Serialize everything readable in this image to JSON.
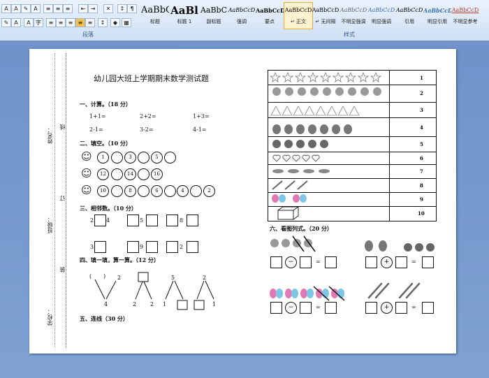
{
  "ribbon": {
    "paragraph_group_label": "段落",
    "styles_group_label": "样式",
    "styles": [
      {
        "sample": "AaBbC",
        "name": "标题"
      },
      {
        "sample": "AaBl",
        "name": "标题 1"
      },
      {
        "sample": "AaBbC",
        "name": "副标题"
      },
      {
        "sample": "AaBbCcD",
        "name": "强调"
      },
      {
        "sample": "AaBbCcD",
        "name": "要点"
      },
      {
        "sample": "AaBbCcD",
        "name": "↵ 正文"
      },
      {
        "sample": "AaBbCcD",
        "name": "↵ 无间隔"
      },
      {
        "sample": "AaBbCcD",
        "name": "不明显强调"
      },
      {
        "sample": "AaBbCcD",
        "name": "明显强调"
      },
      {
        "sample": "AaBbCcD",
        "name": "引用"
      },
      {
        "sample": "AaBbCcD",
        "name": "明显引用"
      },
      {
        "sample": "AaBbCcD",
        "name": "不明显参考"
      }
    ]
  },
  "doc": {
    "title": "幼儿园大班上学期期末数学测试题",
    "margin_labels": {
      "name": "姓名：",
      "class": "班级：",
      "school": "学校：",
      "line": "线",
      "seal": "订",
      "bind": "装"
    },
    "s1": {
      "heading": "一、计算。（18 分）",
      "eqs": [
        "1+1=",
        "2+2=",
        "1+3=",
        "2-1=",
        "3-2=",
        "4-1="
      ]
    },
    "s2": {
      "heading": "二、填空。（10 分）",
      "rows": [
        [
          "1",
          "",
          "3",
          "",
          "5",
          ""
        ],
        [
          "12",
          "",
          "14",
          "",
          "16"
        ],
        [
          "10",
          "",
          "8",
          "",
          "6",
          "",
          "4",
          "",
          "2"
        ]
      ]
    },
    "s3": {
      "heading": "三、相邻数。（10 分）",
      "nums": [
        "4",
        "5",
        "8",
        "2",
        "9",
        "2",
        "3"
      ]
    },
    "s4": {
      "heading": "四、填一填，算一算。（12 分）",
      "nums": [
        "2",
        "4",
        "2",
        "2",
        "5",
        "1",
        "2",
        "1"
      ]
    },
    "s5": {
      "heading": "五、连线（30 分）"
    },
    "table_numbers": [
      "1",
      "2",
      "3",
      "4",
      "5",
      "6",
      "7",
      "8",
      "9",
      "10"
    ],
    "s6": {
      "heading": "六、看图列式。（20 分）",
      "eq_sign": "="
    }
  }
}
